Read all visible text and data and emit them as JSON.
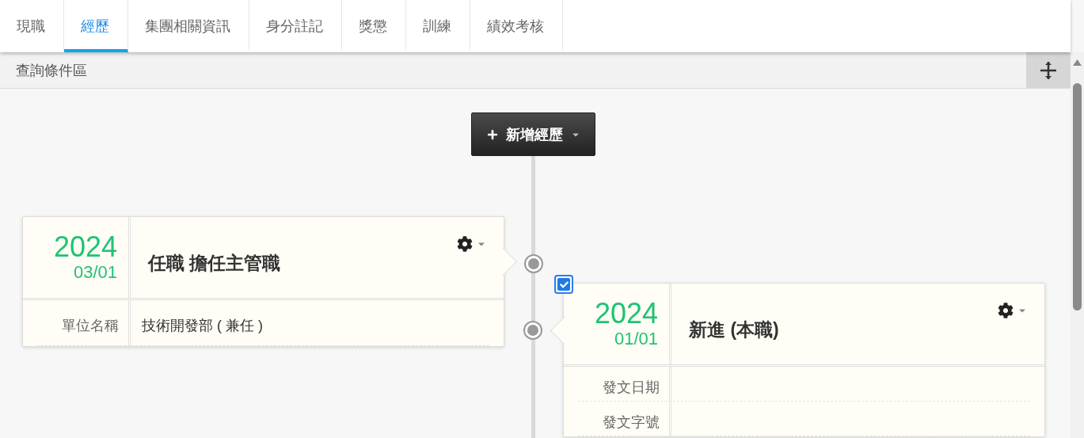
{
  "tabs": [
    {
      "label": "現職",
      "selected": false
    },
    {
      "label": "經歷",
      "selected": true
    },
    {
      "label": "集團相關資訊",
      "selected": false
    },
    {
      "label": "身分註記",
      "selected": false
    },
    {
      "label": "獎懲",
      "selected": false
    },
    {
      "label": "訓練",
      "selected": false
    },
    {
      "label": "績效考核",
      "selected": false
    }
  ],
  "query_bar": {
    "title": "查詢條件區"
  },
  "add_button": {
    "label": "新增經歷"
  },
  "entries": [
    {
      "year": "2024",
      "date": "03/01",
      "title": "任職 擔任主管職",
      "fields": [
        {
          "label": "單位名稱",
          "value": "技術開發部 ( 兼任 )"
        }
      ]
    },
    {
      "year": "2024",
      "date": "01/01",
      "title": "新進 (本職)",
      "checkbox": {
        "checked": true
      },
      "fields": [
        {
          "label": "發文日期"
        },
        {
          "label": "發文字號"
        }
      ]
    }
  ]
}
